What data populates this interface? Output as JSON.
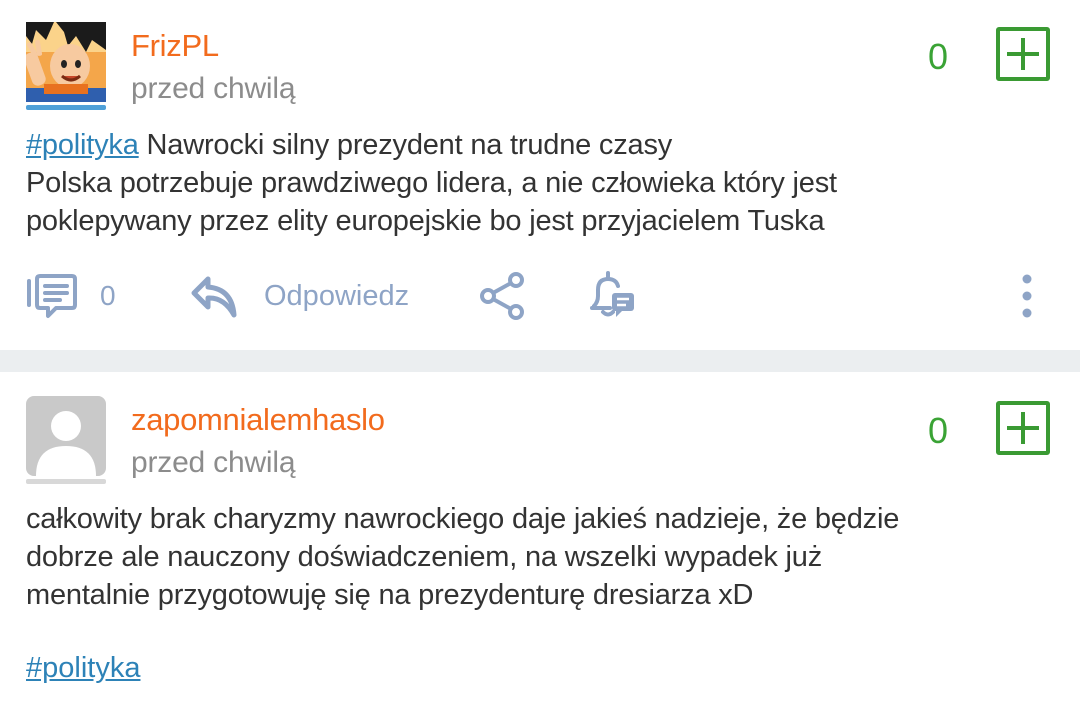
{
  "posts": [
    {
      "username": "FrizPL",
      "timestamp": "przed chwilą",
      "votes": "0",
      "tag": "#polityka",
      "line1_text": " Nawrocki silny prezydent na trudne czasy",
      "line2": "Polska potrzebuje prawdziwego lidera, a nie człowieka który jest",
      "line3": "poklepywany przez elity europejskie bo jest przyjacielem Tuska",
      "comments_count": "0",
      "reply_label": "Odpowiedz"
    },
    {
      "username": "zapomnialemhaslo",
      "timestamp": "przed chwilą",
      "votes": "0",
      "line1": "całkowity brak charyzmy nawrockiego daje jakieś nadzieje, że będzie",
      "line2": "dobrze ale nauczony doświadczeniem, na wszelki wypadek już",
      "line3": "mentalnie przygotowuję się na prezydenturę dresiarza xD",
      "tag": "#polityka"
    }
  ],
  "icons": {
    "comments": "comments-icon",
    "reply": "reply-arrow-icon",
    "share": "share-icon",
    "bell": "notification-bell-icon",
    "more": "more-vertical-icon",
    "upvote": "plus-icon"
  },
  "colors": {
    "username": "#f26b1d",
    "votes": "#3aa335",
    "tag": "#2d82b7",
    "action": "#8ea4c6",
    "separator": "#ebeef0"
  }
}
